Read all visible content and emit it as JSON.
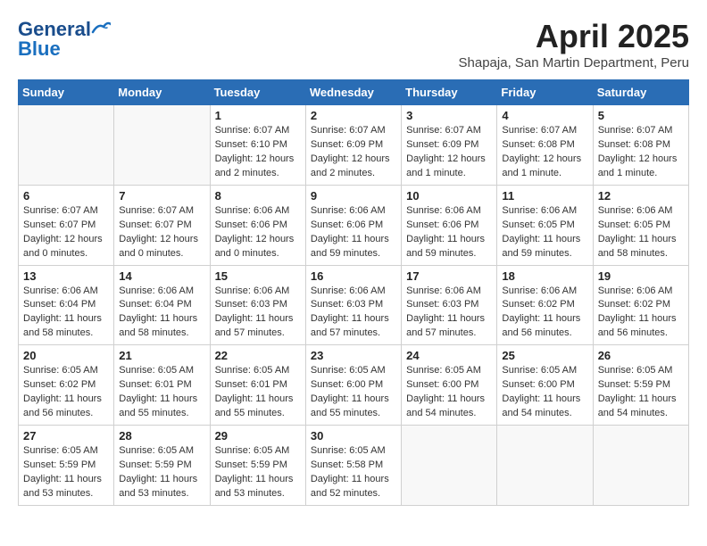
{
  "header": {
    "logo_general": "General",
    "logo_blue": "Blue",
    "month": "April 2025",
    "location": "Shapaja, San Martin Department, Peru"
  },
  "columns": [
    "Sunday",
    "Monday",
    "Tuesday",
    "Wednesday",
    "Thursday",
    "Friday",
    "Saturday"
  ],
  "weeks": [
    [
      {
        "day": "",
        "info": ""
      },
      {
        "day": "",
        "info": ""
      },
      {
        "day": "1",
        "info": "Sunrise: 6:07 AM\nSunset: 6:10 PM\nDaylight: 12 hours and 2 minutes."
      },
      {
        "day": "2",
        "info": "Sunrise: 6:07 AM\nSunset: 6:09 PM\nDaylight: 12 hours and 2 minutes."
      },
      {
        "day": "3",
        "info": "Sunrise: 6:07 AM\nSunset: 6:09 PM\nDaylight: 12 hours and 1 minute."
      },
      {
        "day": "4",
        "info": "Sunrise: 6:07 AM\nSunset: 6:08 PM\nDaylight: 12 hours and 1 minute."
      },
      {
        "day": "5",
        "info": "Sunrise: 6:07 AM\nSunset: 6:08 PM\nDaylight: 12 hours and 1 minute."
      }
    ],
    [
      {
        "day": "6",
        "info": "Sunrise: 6:07 AM\nSunset: 6:07 PM\nDaylight: 12 hours and 0 minutes."
      },
      {
        "day": "7",
        "info": "Sunrise: 6:07 AM\nSunset: 6:07 PM\nDaylight: 12 hours and 0 minutes."
      },
      {
        "day": "8",
        "info": "Sunrise: 6:06 AM\nSunset: 6:06 PM\nDaylight: 12 hours and 0 minutes."
      },
      {
        "day": "9",
        "info": "Sunrise: 6:06 AM\nSunset: 6:06 PM\nDaylight: 11 hours and 59 minutes."
      },
      {
        "day": "10",
        "info": "Sunrise: 6:06 AM\nSunset: 6:06 PM\nDaylight: 11 hours and 59 minutes."
      },
      {
        "day": "11",
        "info": "Sunrise: 6:06 AM\nSunset: 6:05 PM\nDaylight: 11 hours and 59 minutes."
      },
      {
        "day": "12",
        "info": "Sunrise: 6:06 AM\nSunset: 6:05 PM\nDaylight: 11 hours and 58 minutes."
      }
    ],
    [
      {
        "day": "13",
        "info": "Sunrise: 6:06 AM\nSunset: 6:04 PM\nDaylight: 11 hours and 58 minutes."
      },
      {
        "day": "14",
        "info": "Sunrise: 6:06 AM\nSunset: 6:04 PM\nDaylight: 11 hours and 58 minutes."
      },
      {
        "day": "15",
        "info": "Sunrise: 6:06 AM\nSunset: 6:03 PM\nDaylight: 11 hours and 57 minutes."
      },
      {
        "day": "16",
        "info": "Sunrise: 6:06 AM\nSunset: 6:03 PM\nDaylight: 11 hours and 57 minutes."
      },
      {
        "day": "17",
        "info": "Sunrise: 6:06 AM\nSunset: 6:03 PM\nDaylight: 11 hours and 57 minutes."
      },
      {
        "day": "18",
        "info": "Sunrise: 6:06 AM\nSunset: 6:02 PM\nDaylight: 11 hours and 56 minutes."
      },
      {
        "day": "19",
        "info": "Sunrise: 6:06 AM\nSunset: 6:02 PM\nDaylight: 11 hours and 56 minutes."
      }
    ],
    [
      {
        "day": "20",
        "info": "Sunrise: 6:05 AM\nSunset: 6:02 PM\nDaylight: 11 hours and 56 minutes."
      },
      {
        "day": "21",
        "info": "Sunrise: 6:05 AM\nSunset: 6:01 PM\nDaylight: 11 hours and 55 minutes."
      },
      {
        "day": "22",
        "info": "Sunrise: 6:05 AM\nSunset: 6:01 PM\nDaylight: 11 hours and 55 minutes."
      },
      {
        "day": "23",
        "info": "Sunrise: 6:05 AM\nSunset: 6:00 PM\nDaylight: 11 hours and 55 minutes."
      },
      {
        "day": "24",
        "info": "Sunrise: 6:05 AM\nSunset: 6:00 PM\nDaylight: 11 hours and 54 minutes."
      },
      {
        "day": "25",
        "info": "Sunrise: 6:05 AM\nSunset: 6:00 PM\nDaylight: 11 hours and 54 minutes."
      },
      {
        "day": "26",
        "info": "Sunrise: 6:05 AM\nSunset: 5:59 PM\nDaylight: 11 hours and 54 minutes."
      }
    ],
    [
      {
        "day": "27",
        "info": "Sunrise: 6:05 AM\nSunset: 5:59 PM\nDaylight: 11 hours and 53 minutes."
      },
      {
        "day": "28",
        "info": "Sunrise: 6:05 AM\nSunset: 5:59 PM\nDaylight: 11 hours and 53 minutes."
      },
      {
        "day": "29",
        "info": "Sunrise: 6:05 AM\nSunset: 5:59 PM\nDaylight: 11 hours and 53 minutes."
      },
      {
        "day": "30",
        "info": "Sunrise: 6:05 AM\nSunset: 5:58 PM\nDaylight: 11 hours and 52 minutes."
      },
      {
        "day": "",
        "info": ""
      },
      {
        "day": "",
        "info": ""
      },
      {
        "day": "",
        "info": ""
      }
    ]
  ]
}
